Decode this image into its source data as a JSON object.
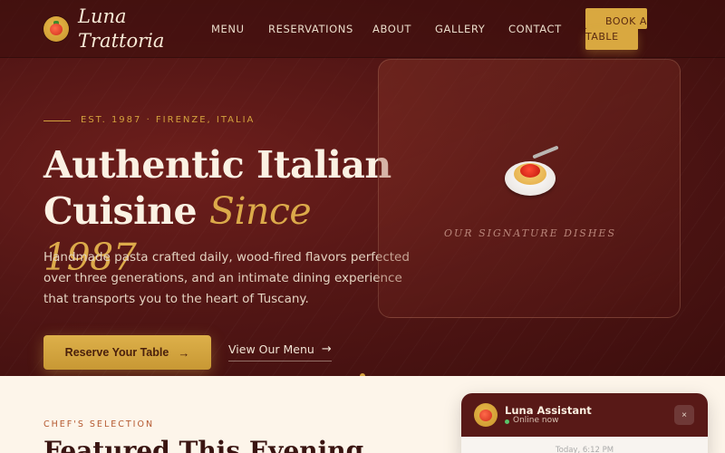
{
  "brand": {
    "name_line1": "Luna",
    "name_line2": "Trattoria"
  },
  "nav": {
    "links": [
      "MENU",
      "RESERVATIONS",
      "ABOUT",
      "GALLERY",
      "CONTACT"
    ],
    "cta_line1": "BOOK A",
    "cta_line2": "TABLE"
  },
  "hero": {
    "eyebrow": "EST. 1987 · FIRENZE, ITALIA",
    "headline_line1": "Authentic Italian",
    "headline_line2_plain": "Cuisine",
    "headline_line2_accent": "Since 1987",
    "subtext": "Handmade pasta crafted daily, wood-fired flavors perfected over three generations, and an intimate dining experience that transports you to the heart of Tuscany.",
    "primary_button": "Reserve Your Table",
    "secondary_link": "View Our Menu",
    "arrow_icon": "→"
  },
  "signature": {
    "caption": "OUR SIGNATURE DISHES",
    "icon": "spaghetti-icon"
  },
  "featured": {
    "eyebrow": "CHEF'S SELECTION",
    "title": "Featured This Evening"
  },
  "chat": {
    "name": "Luna Assistant",
    "status": "Online now",
    "close_icon": "×",
    "timestamp": "Today, 6:12 PM"
  },
  "colors": {
    "hero_bg": "#531615",
    "gold_accent": "#d4a23e",
    "cream": "#fdf5ea",
    "chat_header": "#581917",
    "online_green": "#59c46a"
  }
}
